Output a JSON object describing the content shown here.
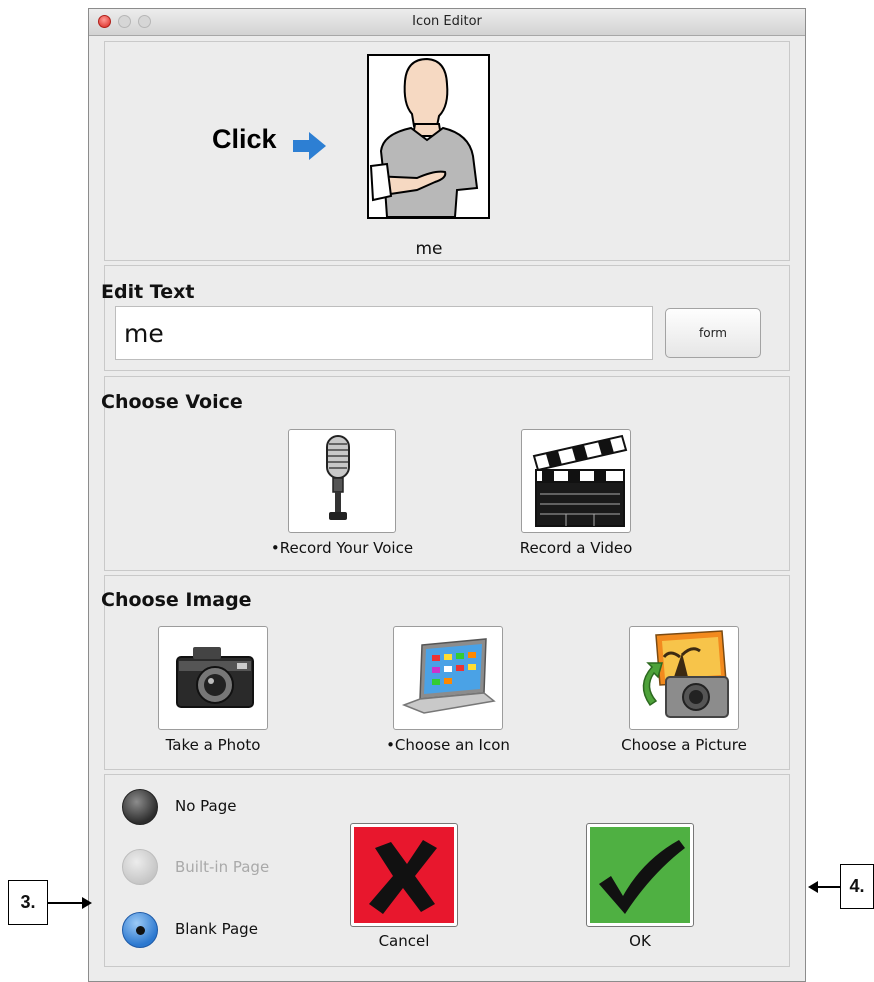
{
  "window": {
    "title": "Icon Editor"
  },
  "preview": {
    "hint": "Click",
    "label": "me"
  },
  "edit_text": {
    "heading": "Edit Text",
    "value": "me",
    "form_button": "form"
  },
  "voice": {
    "heading": "Choose Voice",
    "record_voice": "•Record Your Voice",
    "record_video": "Record a Video"
  },
  "image": {
    "heading": "Choose Image",
    "take_photo": "Take a Photo",
    "choose_icon": "•Choose an Icon",
    "choose_picture": "Choose a Picture"
  },
  "page_options": [
    {
      "label": "No Page",
      "state": "unselected"
    },
    {
      "label": "Built-in Page",
      "state": "disabled"
    },
    {
      "label": "Blank Page",
      "state": "selected"
    }
  ],
  "actions": {
    "cancel": "Cancel",
    "ok": "OK"
  },
  "callouts": {
    "left": "3.",
    "right": "4."
  },
  "colors": {
    "cancel_bg": "#e8172d",
    "ok_bg": "#4fb042",
    "arrow": "#2d7fd3",
    "radio_selected": "#2c78cf"
  }
}
